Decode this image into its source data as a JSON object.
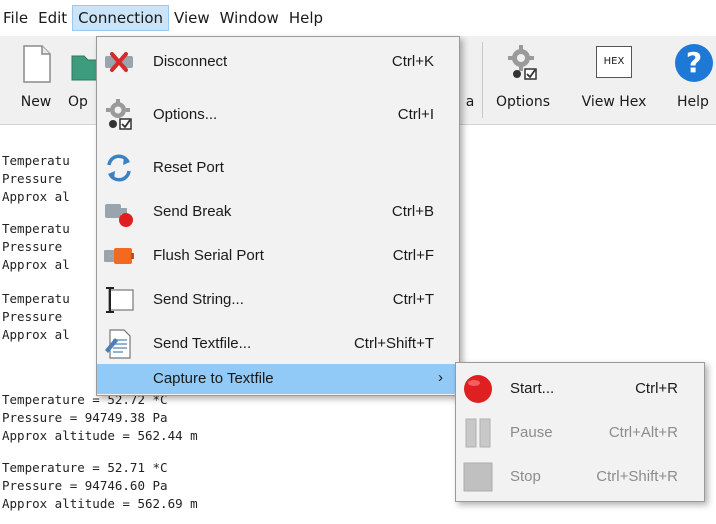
{
  "menubar": {
    "items": [
      "File",
      "Edit",
      "Connection",
      "View",
      "Window",
      "Help"
    ]
  },
  "toolbar": {
    "new_label": "New",
    "open_label": "Op",
    "hidden_label": "a",
    "options_label": "Options",
    "viewhex_label": "View Hex",
    "viewhex_icon_text": "HEX",
    "help_label": "Help",
    "help_icon_text": "?"
  },
  "terminal": {
    "lines": [
      "Temperatu",
      "Pressure ",
      "Approx al",
      "Temperatu",
      "Pressure ",
      "Approx al",
      "Temperatu",
      "Pressure ",
      "Approx al",
      "Temperature = 52.72 *C",
      "Pressure = 94749.38 Pa",
      "Approx altitude = 562.44 m",
      "Temperature = 52.71 *C",
      "Pressure = 94746.60 Pa",
      "Approx altitude = 562.69 m"
    ]
  },
  "connection_menu": {
    "items": [
      {
        "label": "Disconnect",
        "shortcut": "Ctrl+K",
        "icon": "disconnect-icon"
      },
      {
        "label": "Options...",
        "shortcut": "Ctrl+I",
        "icon": "options-gear-icon"
      },
      {
        "label": "Reset Port",
        "shortcut": "",
        "icon": "reset-port-icon"
      },
      {
        "label": "Send Break",
        "shortcut": "Ctrl+B",
        "icon": "send-break-icon"
      },
      {
        "label": "Flush Serial Port",
        "shortcut": "Ctrl+F",
        "icon": "flush-port-icon"
      },
      {
        "label": "Send String...",
        "shortcut": "Ctrl+T",
        "icon": "text-cursor-icon"
      },
      {
        "label": "Send Textfile...",
        "shortcut": "Ctrl+Shift+T",
        "icon": "textfile-icon"
      },
      {
        "label": "Capture to Textfile",
        "shortcut": "",
        "icon": "",
        "submenu_arrow": "›"
      }
    ]
  },
  "capture_submenu": {
    "items": [
      {
        "label": "Start...",
        "shortcut": "Ctrl+R",
        "enabled": true,
        "icon": "record-icon"
      },
      {
        "label": "Pause",
        "shortcut": "Ctrl+Alt+R",
        "enabled": false,
        "icon": "pause-icon"
      },
      {
        "label": "Stop",
        "shortcut": "Ctrl+Shift+R",
        "enabled": false,
        "icon": "stop-icon"
      }
    ]
  },
  "colors": {
    "menu_highlight": "#91c9f7",
    "menubar_active": "#cce4f7",
    "help_icon_blue": "#1e78d6",
    "record_red": "#e02020"
  }
}
